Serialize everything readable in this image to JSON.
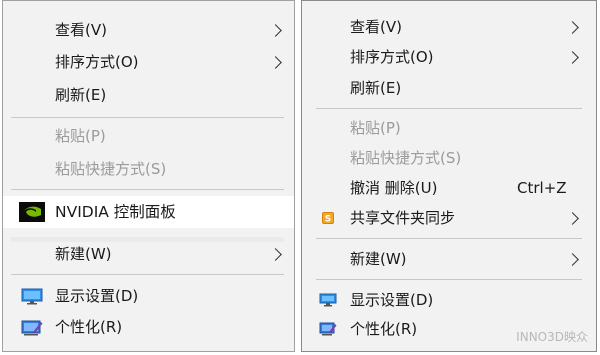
{
  "left_menu": {
    "items": [
      {
        "label": "查看(V)"
      },
      {
        "label": "排序方式(O)"
      },
      {
        "label": "刷新(E)"
      },
      {
        "label": "粘贴(P)"
      },
      {
        "label": "粘贴快捷方式(S)"
      },
      {
        "label": "NVIDIA 控制面板"
      },
      {
        "label": "新建(W)"
      },
      {
        "label": "显示设置(D)"
      },
      {
        "label": "个性化(R)"
      }
    ]
  },
  "right_menu": {
    "items": [
      {
        "label": "查看(V)"
      },
      {
        "label": "排序方式(O)"
      },
      {
        "label": "刷新(E)"
      },
      {
        "label": "粘贴(P)"
      },
      {
        "label": "粘贴快捷方式(S)"
      },
      {
        "label": "撤消 删除(U)",
        "shortcut": "Ctrl+Z"
      },
      {
        "label": "共享文件夹同步"
      },
      {
        "label": "新建(W)"
      },
      {
        "label": "显示设置(D)"
      },
      {
        "label": "个性化(R)"
      }
    ]
  },
  "watermark": "INNO3D映众",
  "colors": {
    "menu_bg": "#f2f2f2",
    "disabled_text": "#9b9b9b",
    "nvidia_green": "#76b900",
    "display_icon_blue": "#1e6fc4"
  },
  "icons": {
    "nvidia": "nvidia-logo-icon",
    "share_sync": "share-sync-icon",
    "display": "display-settings-icon",
    "personalize": "personalize-icon",
    "submenu": "chevron-right-icon"
  }
}
